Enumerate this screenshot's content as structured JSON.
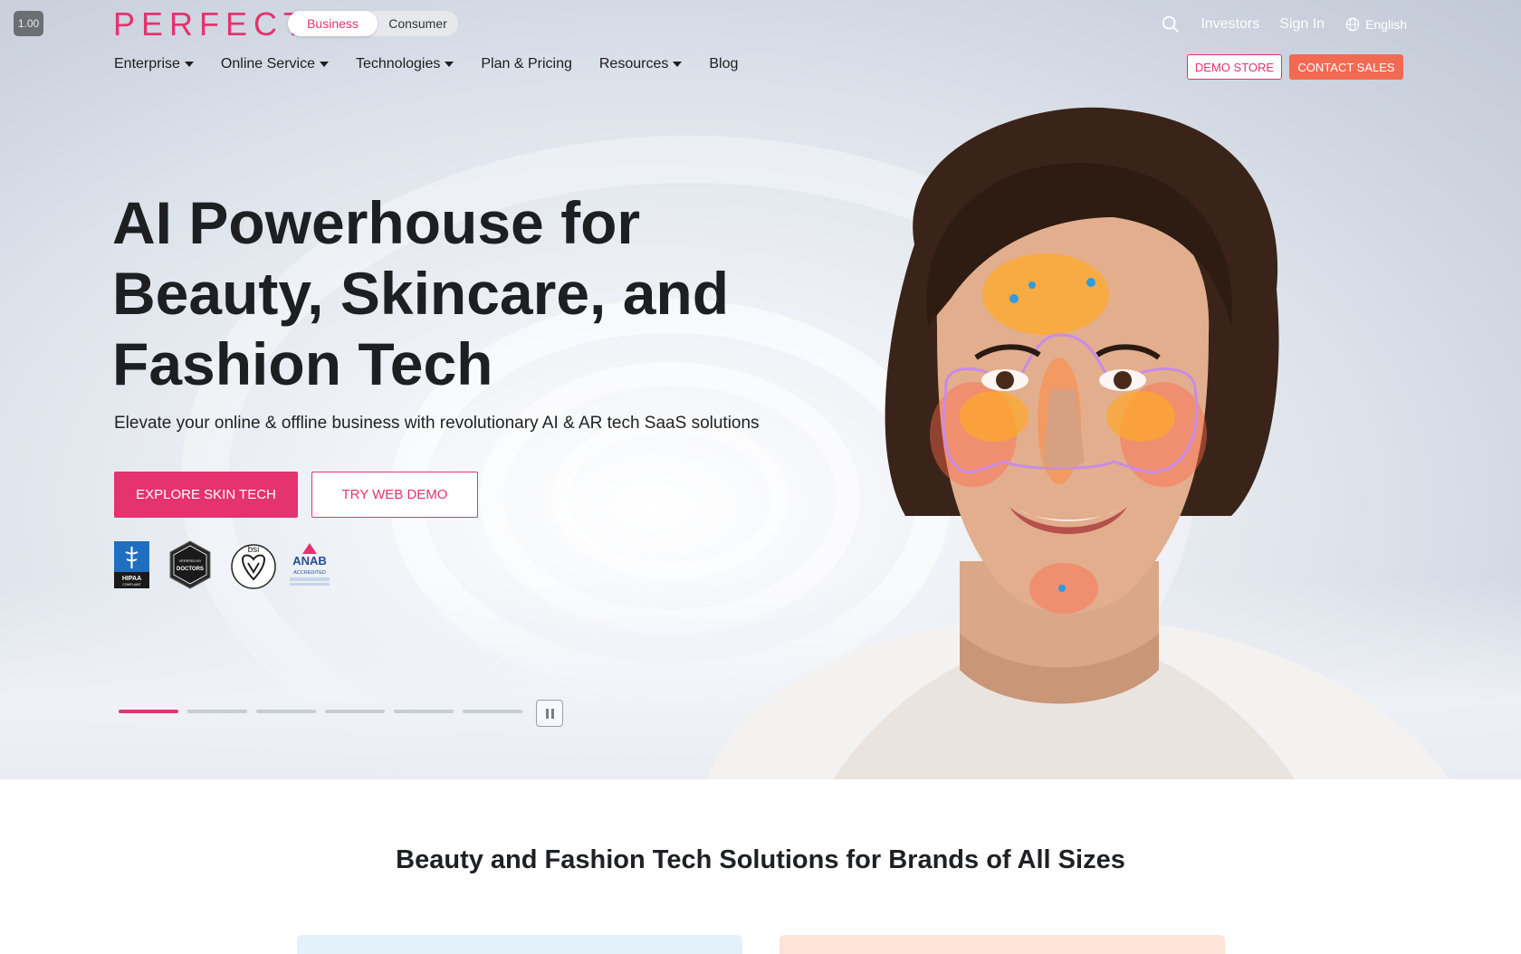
{
  "version_badge": "1.00",
  "brand": {
    "logo": "PERFECT",
    "accent": "#e4336f"
  },
  "audience_switch": {
    "business": "Business",
    "consumer": "Consumer",
    "selected": "Business"
  },
  "top_links": {
    "investors": "Investors",
    "sign_in": "Sign In",
    "language": "English"
  },
  "icons": {
    "search": "search-icon",
    "globe": "globe-icon",
    "pause": "pause-icon"
  },
  "nav": {
    "items": [
      {
        "label": "Enterprise",
        "dropdown": true
      },
      {
        "label": "Online Service",
        "dropdown": true
      },
      {
        "label": "Technologies",
        "dropdown": true
      },
      {
        "label": "Plan & Pricing",
        "dropdown": false
      },
      {
        "label": "Resources",
        "dropdown": true
      },
      {
        "label": "Blog",
        "dropdown": false
      }
    ],
    "demo_store": "DEMO STORE",
    "contact_sales": "CONTACT SALES"
  },
  "hero": {
    "headline_line1": "AI Powerhouse for",
    "headline_line2": "Beauty, Skincare, and",
    "headline_line3": "Fashion Tech",
    "subhead": "Elevate your online & offline business with revolutionary AI & AR tech SaaS solutions",
    "primary_cta": "EXPLORE SKIN TECH",
    "secondary_cta": "TRY WEB DEMO",
    "badges": {
      "hipaa": "HIPAA",
      "hipaa_sub": "COMPLIANT",
      "doctors_top": "VERIFIED BY",
      "doctors": "DOCTORS",
      "bsi": "bsi",
      "anab": "ANAB",
      "anab_sub": "ACCREDITED"
    },
    "carousel": {
      "slides": 6,
      "active_index": 0
    }
  },
  "section": {
    "title": "Beauty and Fashion Tech Solutions for Brands of All Sizes"
  },
  "colors": {
    "primary": "#e4336f",
    "contact": "#f36a52",
    "card_blue": "#e3f1fb",
    "card_peach": "#fde3d8"
  }
}
